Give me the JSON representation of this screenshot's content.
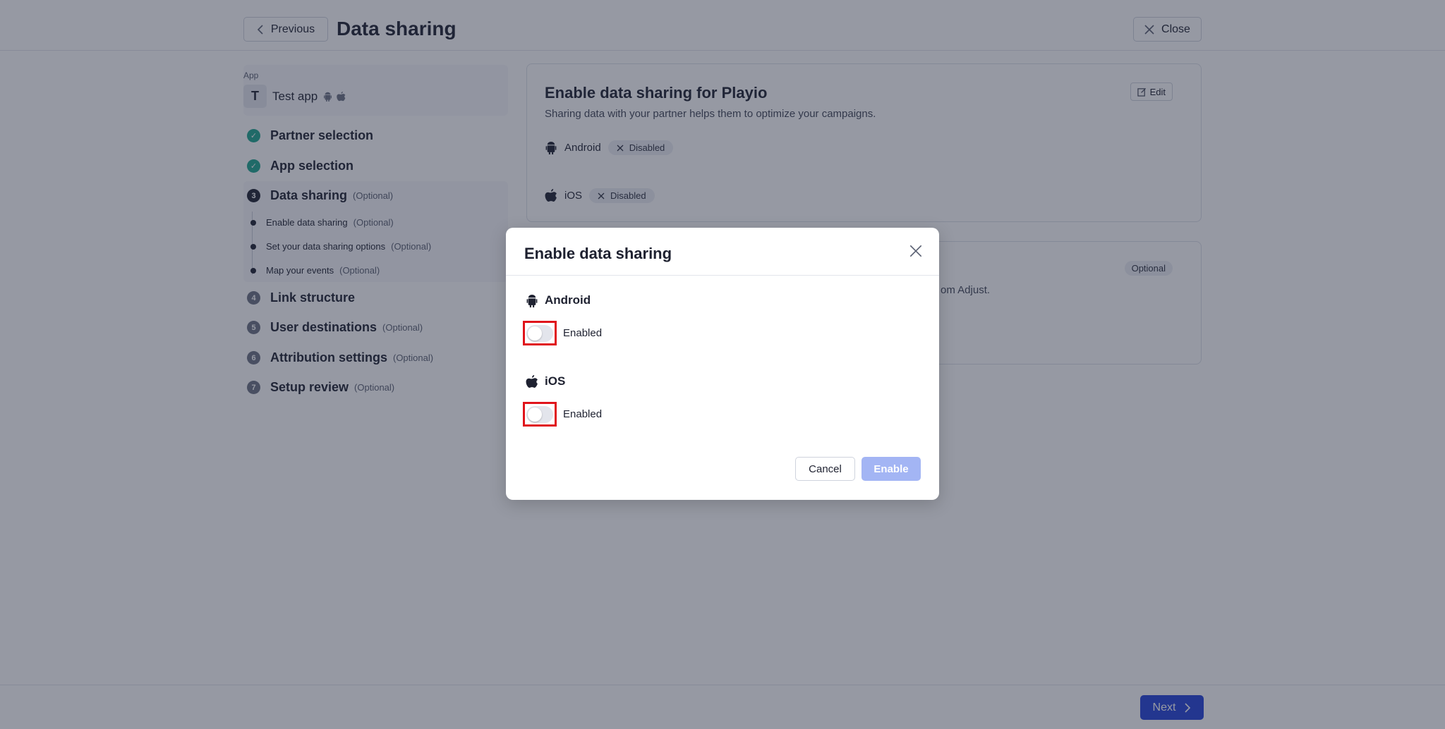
{
  "header": {
    "previous_label": "Previous",
    "title": "Data sharing",
    "close_label": "Close"
  },
  "sidebar": {
    "app_label": "App",
    "app_avatar": "T",
    "app_name": "Test app",
    "steps": [
      {
        "number": "1",
        "label": "Partner selection",
        "optional": "",
        "state": "done"
      },
      {
        "number": "2",
        "label": "App selection",
        "optional": "",
        "state": "done"
      },
      {
        "number": "3",
        "label": "Data sharing",
        "optional": "(Optional)",
        "state": "current"
      },
      {
        "number": "4",
        "label": "Link structure",
        "optional": "",
        "state": "todo"
      },
      {
        "number": "5",
        "label": "User destinations",
        "optional": "(Optional)",
        "state": "todo"
      },
      {
        "number": "6",
        "label": "Attribution settings",
        "optional": "(Optional)",
        "state": "todo"
      },
      {
        "number": "7",
        "label": "Setup review",
        "optional": "(Optional)",
        "state": "todo"
      }
    ],
    "substeps": [
      {
        "label": "Enable data sharing",
        "optional": "(Optional)"
      },
      {
        "label": "Set your data sharing options",
        "optional": "(Optional)"
      },
      {
        "label": "Map your events",
        "optional": "(Optional)"
      }
    ]
  },
  "card1": {
    "title": "Enable data sharing for Playio",
    "subtitle": "Sharing data with your partner helps them to optimize your campaigns.",
    "edit_label": "Edit",
    "android_label": "Android",
    "android_status": "Disabled",
    "ios_label": "iOS",
    "ios_status": "Disabled"
  },
  "card2": {
    "optional_label": "Optional",
    "text_fragment": "om Adjust."
  },
  "footer": {
    "next_label": "Next"
  },
  "modal": {
    "title": "Enable data sharing",
    "android_label": "Android",
    "android_toggle_label": "Enabled",
    "android_toggle_on": false,
    "ios_label": "iOS",
    "ios_toggle_label": "Enabled",
    "ios_toggle_on": false,
    "cancel_label": "Cancel",
    "enable_label": "Enable"
  },
  "colors": {
    "accent": "#2442d8",
    "done": "#1ea58e",
    "highlight": "#e0141b",
    "enable_disabled": "#a3b5f4"
  },
  "icons": {
    "android": "android-icon",
    "apple": "apple-icon",
    "check": "check-icon",
    "close": "close-icon",
    "chevron_left": "chevron-left-icon",
    "chevron_right": "chevron-right-icon",
    "edit": "edit-icon"
  }
}
